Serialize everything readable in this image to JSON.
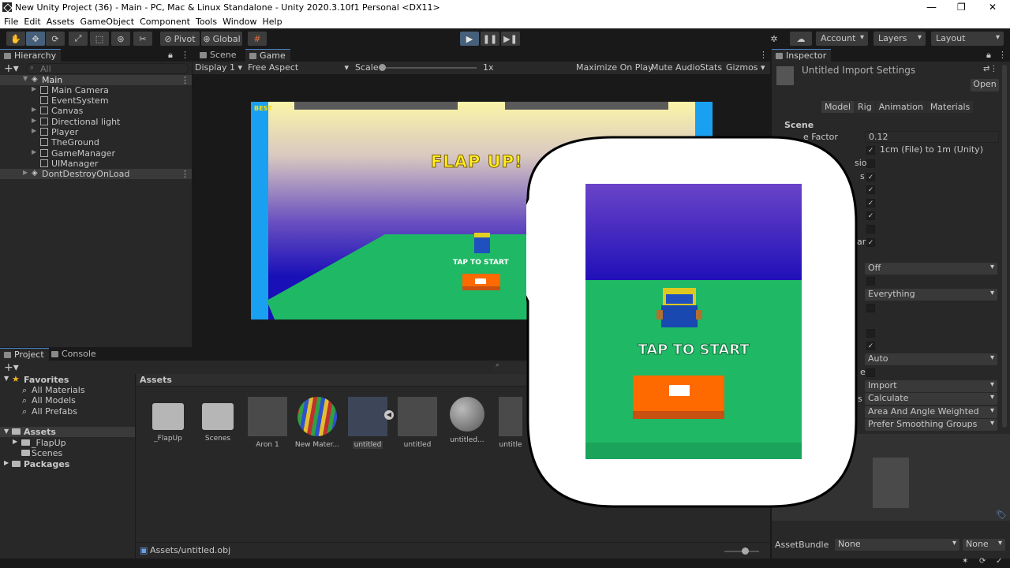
{
  "window": {
    "title": "New Unity Project (36) - Main - PC, Mac & Linux Standalone - Unity 2020.3.10f1 Personal <DX11>",
    "minimize": "—",
    "maximize": "❐",
    "close": "✕"
  },
  "menu": [
    "File",
    "Edit",
    "Assets",
    "GameObject",
    "Component",
    "Tools",
    "Window",
    "Help"
  ],
  "toolbar": {
    "pivot": "Pivot",
    "global": "Global",
    "account": "Account",
    "layers": "Layers",
    "layout": "Layout"
  },
  "hierarchy": {
    "tab": "Hierarchy",
    "search_placeholder": "All",
    "scene_name": "Main",
    "items": [
      "Main Camera",
      "EventSystem",
      "Canvas",
      "Directional light",
      "Player",
      "TheGround",
      "GameManager",
      "UIManager"
    ],
    "ddol": "DontDestroyOnLoad"
  },
  "game_view": {
    "tabs": [
      "Scene",
      "Game"
    ],
    "display": "Display 1",
    "aspect": "Free Aspect",
    "scale_label": "Scale",
    "scale_value": "1x",
    "maximize": "Maximize On Play",
    "mute": "Mute Audio",
    "stats": "Stats",
    "gizmos": "Gizmos",
    "game_title": "FLAP UP!",
    "tap_to_start": "TAP TO START",
    "best_label": "BEST"
  },
  "inspector": {
    "tab": "Inspector",
    "header": "Untitled Import Settings",
    "open": "Open",
    "subtabs": [
      "Model",
      "Rig",
      "Animation",
      "Materials"
    ],
    "section": "Scene",
    "scale_factor_label": "e Factor",
    "scale_factor": "0.12",
    "convert_units": "1cm (File) to 1m (Unity)",
    "visible_label_1": "sion",
    "visible_label_2": "s",
    "visible_label_3": "ar",
    "mesh_compression": "Off",
    "read_write": "Everything",
    "normals": "Auto",
    "normals_mode": "Import",
    "tangents": "Calculate",
    "smoothness": "Area And Angle Weighted",
    "smoothing": "Prefer Smoothing Groups",
    "label_e": "e",
    "label_ls": "ls",
    "asset_bundle_label": "AssetBundle",
    "asset_bundle": "None",
    "asset_bundle_variant": "None"
  },
  "project": {
    "tabs": [
      "Project",
      "Console"
    ],
    "favorites": "Favorites",
    "fav_items": [
      "All Materials",
      "All Models",
      "All Prefabs"
    ],
    "assets_root": "Assets",
    "asset_folders": [
      "_FlapUp",
      "Scenes"
    ],
    "packages": "Packages",
    "breadcrumb": "Assets",
    "assets": [
      "_FlapUp",
      "Scenes",
      "Aron 1",
      "New Mater...",
      "untitled",
      "untitled",
      "untitled...",
      "untitle"
    ],
    "status_path": "Assets/untitled.obj"
  },
  "colors": {
    "play_active": "#46607c",
    "accent_blue": "#4a82c8",
    "ground_green": "#1fb865",
    "start_button": "#ff6a00"
  }
}
